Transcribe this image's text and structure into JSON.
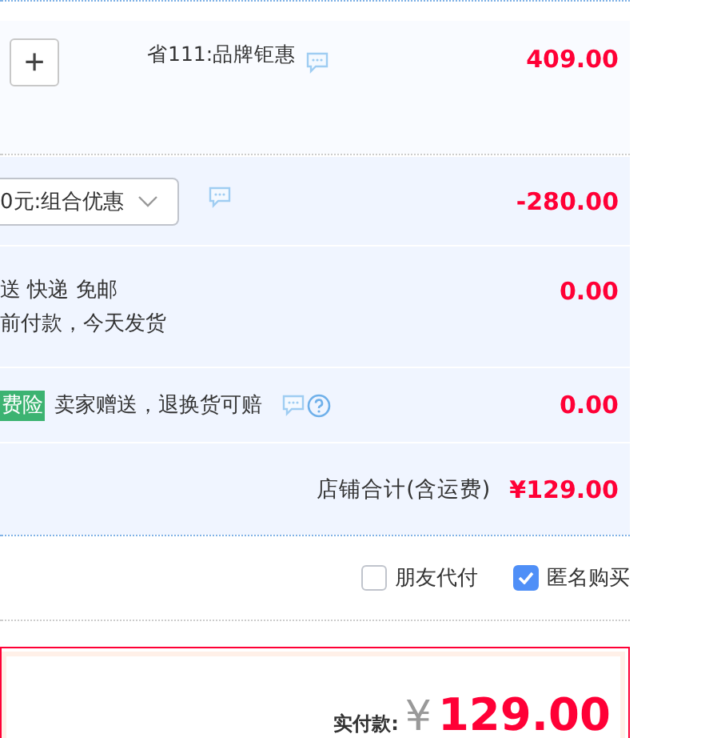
{
  "product": {
    "stepper_label": "+",
    "promo": "省111:品牌钜惠",
    "price": "409.00"
  },
  "discount": {
    "dropdown_value": "0元:组合优惠",
    "amount": "-280.00"
  },
  "shipping": {
    "lines": [
      "送 快递 免邮",
      "前付款，今天发货"
    ],
    "amount": "0.00"
  },
  "insurance": {
    "badge": "费险",
    "text": "卖家赠送，退换货可赔",
    "amount": "0.00"
  },
  "shop_total": {
    "label": "店铺合计(含运费)",
    "amount": "¥129.00"
  },
  "options": [
    {
      "label": "朋友代付",
      "checked": false
    },
    {
      "label": "匿名购买",
      "checked": true
    }
  ],
  "payment": {
    "label": "实付款:",
    "currency": "¥",
    "amount": "129.00"
  }
}
